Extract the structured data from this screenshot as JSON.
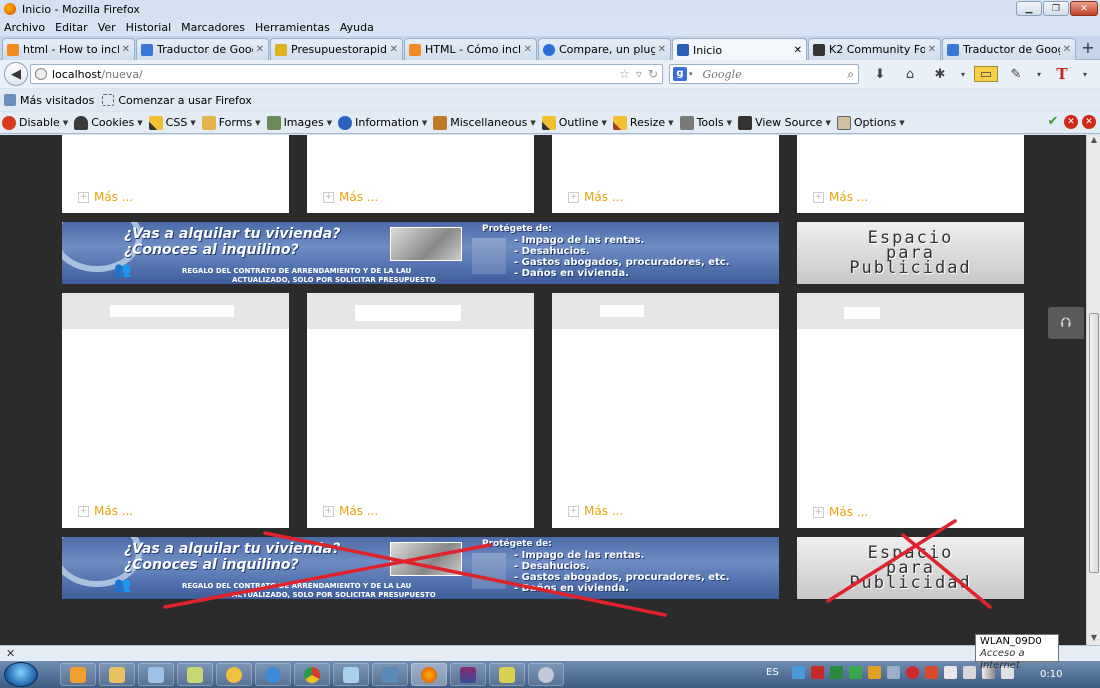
{
  "window": {
    "title": "Inicio - Mozilla Firefox"
  },
  "menu": [
    "Archivo",
    "Editar",
    "Ver",
    "Historial",
    "Marcadores",
    "Herramientas",
    "Ayuda"
  ],
  "tabs": [
    {
      "label": "html - How to inclu...",
      "color": "#f28b1f"
    },
    {
      "label": "Traductor de Google",
      "color": "#3a78d8"
    },
    {
      "label": "Presupuestorapido ...",
      "color": "#e0b020"
    },
    {
      "label": "HTML - Cómo incl...",
      "color": "#f28b1f"
    },
    {
      "label": "Compare, un plugi...",
      "color": "#2a6ed8"
    },
    {
      "label": "Inicio",
      "color": "#2b5fb5"
    },
    {
      "label": "K2 Community For...",
      "color": "#333333"
    },
    {
      "label": "Traductor de Google",
      "color": "#3a78d8"
    }
  ],
  "nav": {
    "url_host": "localhost",
    "url_path": "/nueva/",
    "search_placeholder": "Google"
  },
  "bookmarks": [
    "Más visitados",
    "Comenzar a usar Firefox"
  ],
  "devtools": [
    "Disable",
    "Cookies",
    "CSS",
    "Forms",
    "Images",
    "Information",
    "Miscellaneous",
    "Outline",
    "Resize",
    "Tools",
    "View Source",
    "Options"
  ],
  "content": {
    "more_label": "Más ...",
    "banner": {
      "q1": "¿Vas a alquilar tu vivienda?",
      "q2": "¿Conoces al inquilino?",
      "fine1": "REGALO DEL CONTRATO DE ARRENDAMIENTO Y DE LA LAU",
      "fine2": "ACTUALIZADO, SOLO POR SOLICITAR PRESUPUESTO",
      "protect": "Protégete de:",
      "items": [
        "- Impago de las rentas.",
        "- Desahucios.",
        "- Gastos abogados, procuradores, etc.",
        "- Daños en vivienda."
      ]
    },
    "ad": [
      "Espacio",
      "para",
      "Publicidad"
    ]
  },
  "status": {
    "tooltip_title": "WLAN_09D0",
    "tooltip_sub": "Acceso a Internet"
  },
  "taskbar": {
    "lang": "ES",
    "clock": "0:10"
  }
}
